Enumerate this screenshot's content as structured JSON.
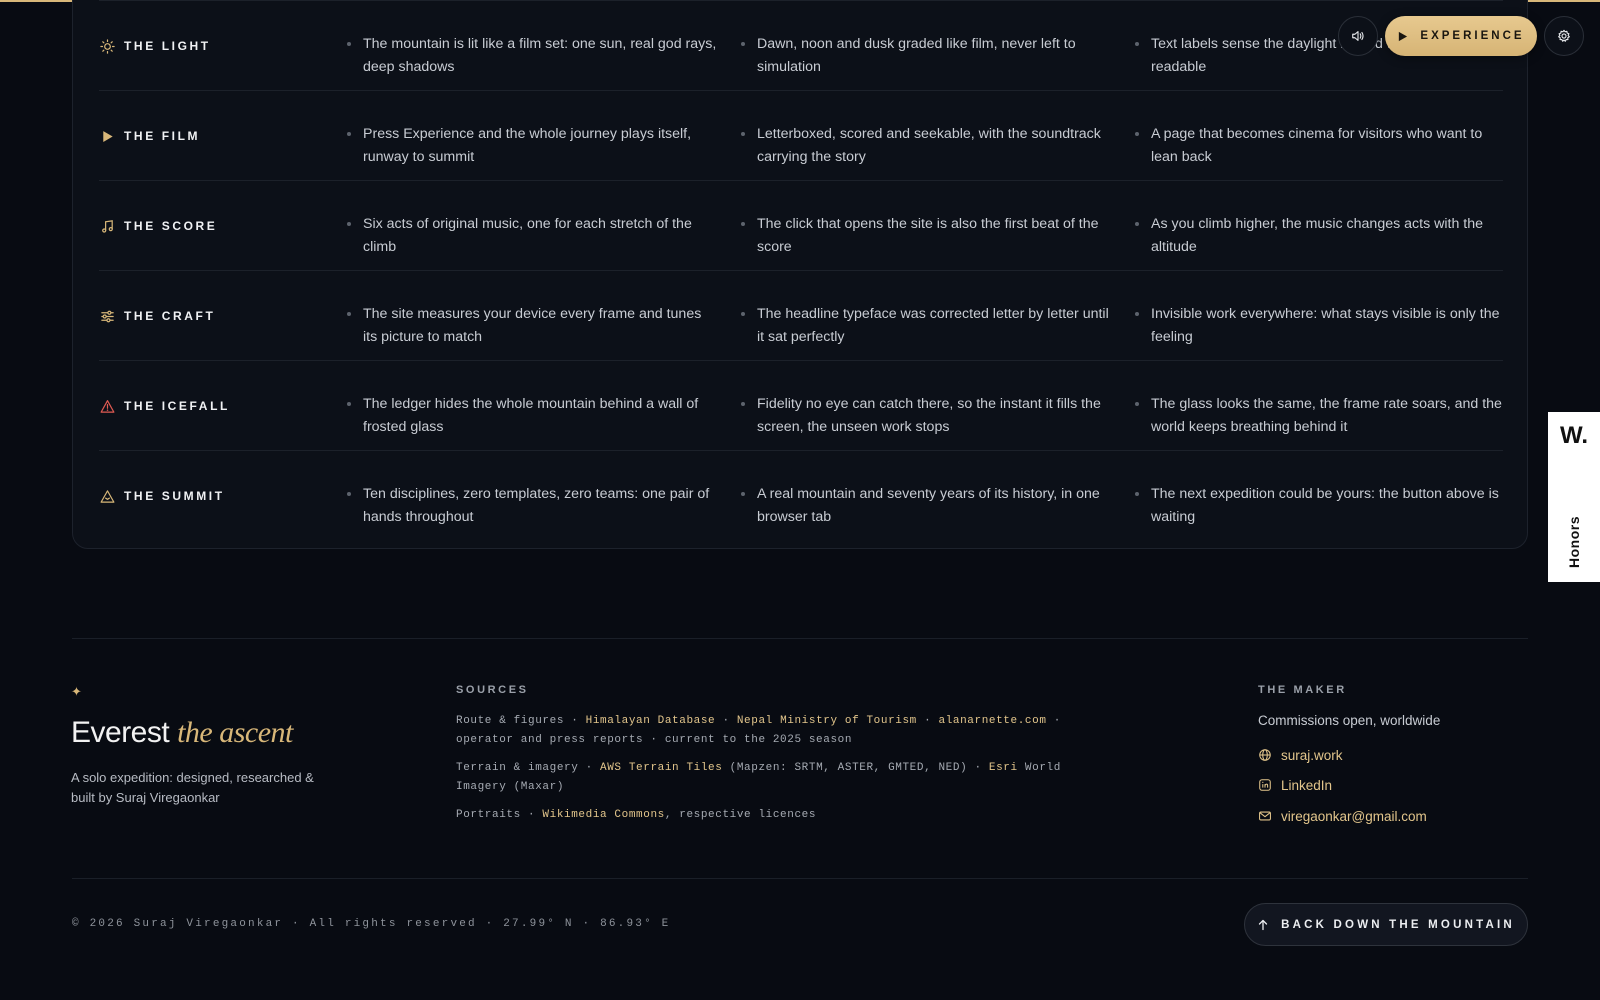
{
  "colors": {
    "background": "#080b12",
    "card": "#0c1018",
    "accent_gold": "#d8b779",
    "alert_red": "#e05a52",
    "text": "#c8ccd3"
  },
  "features": [
    {
      "icon": "sun-icon",
      "title": "THE LIGHT",
      "points": [
        "The mountain is lit like a film set: one sun, real god rays, deep shadows",
        "Dawn, noon and dusk graded like film, never left to simulation",
        "Text labels sense the daylight behind them and stay readable"
      ]
    },
    {
      "icon": "play-icon",
      "title": "THE FILM",
      "points": [
        "Press Experience and the whole journey plays itself, runway to summit",
        "Letterboxed, scored and seekable, with the soundtrack carrying the story",
        "A page that becomes cinema for visitors who want to lean back"
      ]
    },
    {
      "icon": "music-note-icon",
      "title": "THE SCORE",
      "points": [
        "Six acts of original music, one for each stretch of the climb",
        "The click that opens the site is also the first beat of the score",
        "As you climb higher, the music changes acts with the altitude"
      ]
    },
    {
      "icon": "sliders-icon",
      "title": "THE CRAFT",
      "points": [
        "The site measures your device every frame and tunes its picture to match",
        "The headline typeface was corrected letter by letter until it sat perfectly",
        "Invisible work everywhere: what stays visible is only the feeling"
      ]
    },
    {
      "icon": "warning-triangle-icon",
      "title": "THE ICEFALL",
      "points": [
        "The ledger hides the whole mountain behind a wall of frosted glass",
        "Fidelity no eye can catch there, so the instant it fills the screen, the unseen work stops",
        "The glass looks the same, the frame rate soars, and the world keeps breathing behind it"
      ]
    },
    {
      "icon": "mountain-icon",
      "title": "THE SUMMIT",
      "points": [
        "Ten disciplines, zero templates, zero teams: one pair of hands throughout",
        "A real mountain and seventy years of its history, in one browser tab",
        "The next expedition could be yours: the button above is waiting"
      ]
    }
  ],
  "controls": {
    "sound_icon": "speaker-icon",
    "experience_label": "EXPERIENCE",
    "settings_icon": "gear-icon"
  },
  "honors": {
    "logo": "W.",
    "label": "Honors"
  },
  "footer": {
    "brand": {
      "title_main": "Everest",
      "title_accent": "the ascent",
      "tagline": "A solo expedition: designed, researched & built by Suraj Viregaonkar"
    },
    "sources": {
      "heading": "SOURCES",
      "line1": {
        "prefix": "Route & figures · ",
        "link1": "Himalayan Database",
        "sep1": " · ",
        "link2": "Nepal Ministry of Tourism",
        "sep2": " · ",
        "link3": "alanarnette.com",
        "suffix": " · operator and press reports · current to the 2025 season"
      },
      "line2": {
        "prefix": "Terrain & imagery · ",
        "link1": "AWS Terrain Tiles",
        "mid": " (Mapzen: SRTM, ASTER, GMTED, NED) · ",
        "link2": "Esri",
        "suffix": " World Imagery (Maxar)"
      },
      "line3": {
        "prefix": "Portraits · ",
        "link1": "Wikimedia Commons",
        "suffix": ", respective licences"
      }
    },
    "maker": {
      "heading": "THE MAKER",
      "subtitle": "Commissions open, worldwide",
      "links": [
        {
          "icon": "globe-icon",
          "label": "suraj.work"
        },
        {
          "icon": "linkedin-icon",
          "label": "LinkedIn"
        },
        {
          "icon": "mail-icon",
          "label": "viregaonkar@gmail.com"
        }
      ]
    },
    "copyright": "© 2026 Suraj Viregaonkar · All rights reserved · 27.99° N · 86.93° E",
    "back_button": "BACK DOWN THE MOUNTAIN"
  }
}
